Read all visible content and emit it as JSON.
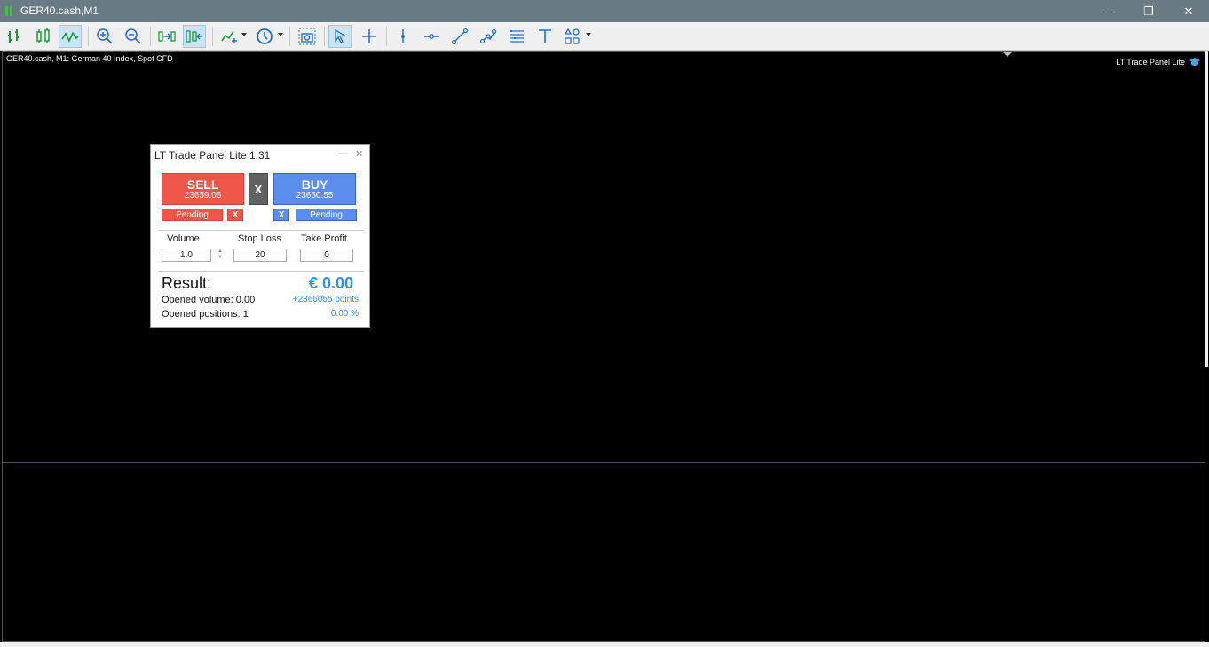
{
  "window": {
    "title": "GER40.cash,M1",
    "min_glyph": "—",
    "max_glyph": "❐",
    "close_glyph": "✕"
  },
  "toolbar": {
    "items": [
      "bar-chart-icon",
      "candlestick-icon",
      "line-chart-icon",
      "zoom-in-icon",
      "zoom-out-icon",
      "autoscroll-icon",
      "chart-shift-icon",
      "indicators-icon",
      "timeframes-icon",
      "screenshot-icon",
      "cursor-icon",
      "crosshair-icon",
      "vertical-line-icon",
      "horizontal-line-icon",
      "trendline-icon",
      "channel-icon",
      "fibonacci-icon",
      "text-icon",
      "shapes-icon"
    ],
    "active": [
      "line-chart-icon",
      "chart-shift-icon",
      "cursor-icon"
    ]
  },
  "chart": {
    "symbol_label": "GER40.cash, M1:  German 40 Index, Spot CFD",
    "indicator_label": "LT Trade Panel Lite"
  },
  "panel": {
    "title": "LT Trade Panel Lite 1.31",
    "minimize": "—",
    "close": "✕",
    "sell": {
      "label": "SELL",
      "price": "23659.06"
    },
    "buy": {
      "label": "BUY",
      "price": "23660.55"
    },
    "close_all": "X",
    "pending_sell": "Pending",
    "pending_buy": "Pending",
    "x_sell": "X",
    "x_buy": "X",
    "volume_label": "Volume",
    "stop_loss_label": "Stop Loss",
    "take_profit_label": "Take Profit",
    "volume_value": "1.0",
    "stop_loss_value": "20",
    "take_profit_value": "0",
    "result_label": "Result:",
    "result_value": "€ 0.00",
    "opened_volume": "Opened volume: 0.00",
    "opened_positions": "Opened positions: 1",
    "points": "+2366055 points",
    "percent": "0.00 %"
  },
  "colors": {
    "sell": "#f0564a",
    "buy": "#5b8def",
    "accent": "#2e91e8",
    "titlebar": "#6b7b86"
  }
}
